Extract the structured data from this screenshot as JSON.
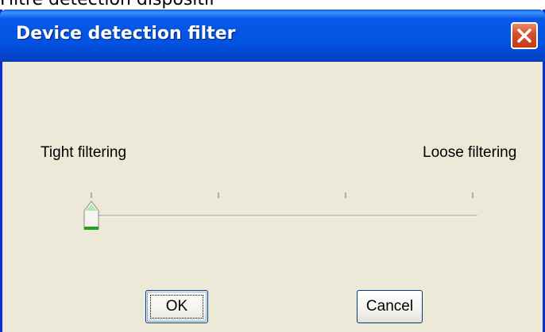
{
  "page_caption": "Filtre détection dispositif",
  "window": {
    "title": "Device detection filter",
    "close_icon": "close-x-icon"
  },
  "slider": {
    "left_label": "Tight filtering",
    "right_label": "Loose filtering",
    "tick_count": 4,
    "value_fraction": 0.0,
    "thumb_icon": "slider-thumb-icon"
  },
  "buttons": {
    "ok_label": "OK",
    "cancel_label": "Cancel"
  },
  "colors": {
    "titlebar": "#0354e3",
    "dialog_background": "#ece9d8",
    "close_button": "#d9512b",
    "thumb_accent": "#21a121"
  }
}
